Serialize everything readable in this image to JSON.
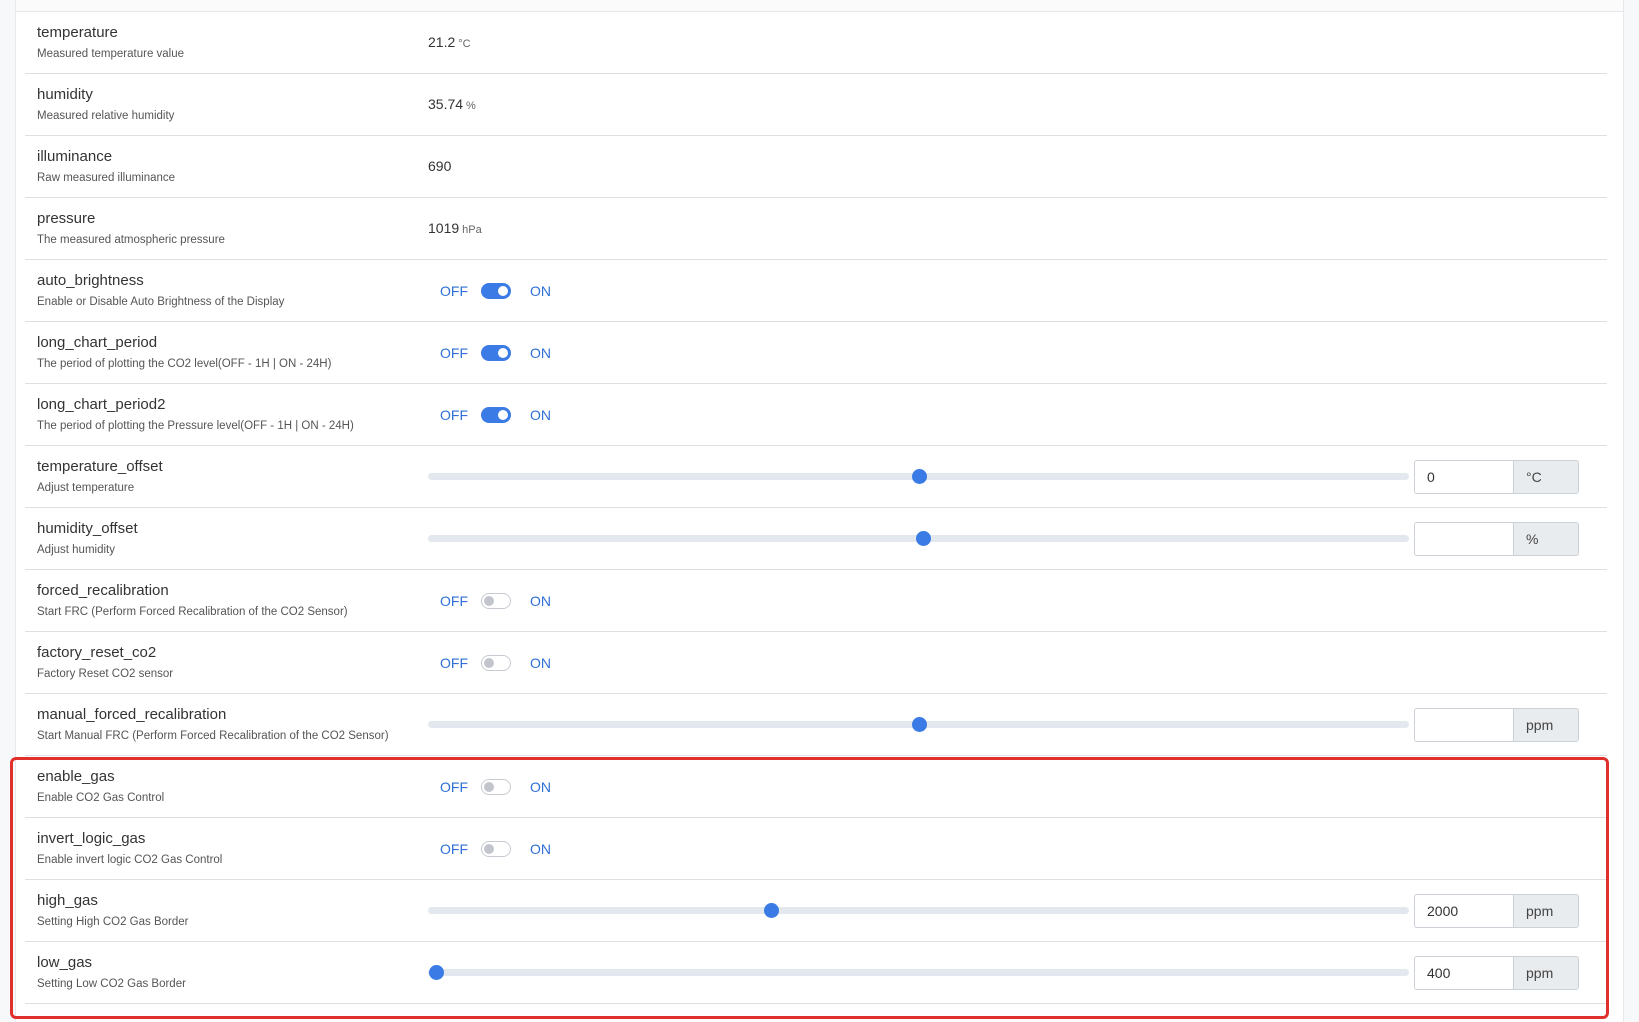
{
  "rows": [
    {
      "type": "value",
      "name": "temperature",
      "desc": "Measured temperature value",
      "value": "21.2",
      "unit": "°C"
    },
    {
      "type": "value",
      "name": "humidity",
      "desc": "Measured relative humidity",
      "value": "35.74",
      "unit": "%"
    },
    {
      "type": "value",
      "name": "illuminance",
      "desc": "Raw measured illuminance",
      "value": "690",
      "unit": ""
    },
    {
      "type": "value",
      "name": "pressure",
      "desc": "The measured atmospheric pressure",
      "value": "1019",
      "unit": "hPa"
    },
    {
      "type": "toggle",
      "name": "auto_brightness",
      "desc": "Enable or Disable Auto Brightness of the Display",
      "state": true
    },
    {
      "type": "toggle",
      "name": "long_chart_period",
      "desc": "The period of plotting the CO2 level(OFF - 1H | ON - 24H)",
      "state": true
    },
    {
      "type": "toggle",
      "name": "long_chart_period2",
      "desc": "The period of plotting the Pressure level(OFF - 1H | ON - 24H)",
      "state": true
    },
    {
      "type": "slider",
      "name": "temperature_offset",
      "desc": "Adjust temperature",
      "level": 0.5,
      "input": "0",
      "unit": "°C"
    },
    {
      "type": "slider",
      "name": "humidity_offset",
      "desc": "Adjust humidity",
      "level": 0.505,
      "input": "",
      "unit": "%"
    },
    {
      "type": "toggle",
      "name": "forced_recalibration",
      "desc": "Start FRC (Perform Forced Recalibration of the CO2 Sensor)",
      "state": false
    },
    {
      "type": "toggle",
      "name": "factory_reset_co2",
      "desc": "Factory Reset CO2 sensor",
      "state": false
    },
    {
      "type": "slider",
      "name": "manual_forced_recalibration",
      "desc": "Start Manual FRC (Perform Forced Recalibration of the CO2 Sensor)",
      "level": 0.5,
      "input": "",
      "unit": "ppm"
    },
    {
      "type": "toggle",
      "name": "enable_gas",
      "desc": "Enable CO2 Gas Control",
      "state": false
    },
    {
      "type": "toggle",
      "name": "invert_logic_gas",
      "desc": "Enable invert logic CO2 Gas Control",
      "state": false
    },
    {
      "type": "slider",
      "name": "high_gas",
      "desc": "Setting High CO2 Gas Border",
      "level": 0.35,
      "input": "2000",
      "unit": "ppm"
    },
    {
      "type": "slider",
      "name": "low_gas",
      "desc": "Setting Low CO2 Gas Border",
      "level": 0.008,
      "input": "400",
      "unit": "ppm"
    }
  ],
  "toggle_labels": {
    "off": "OFF",
    "on": "ON"
  },
  "colors": {
    "accent": "#3a7be6",
    "highlight": "#e0302c",
    "label_blue": "#2f6fd6"
  }
}
